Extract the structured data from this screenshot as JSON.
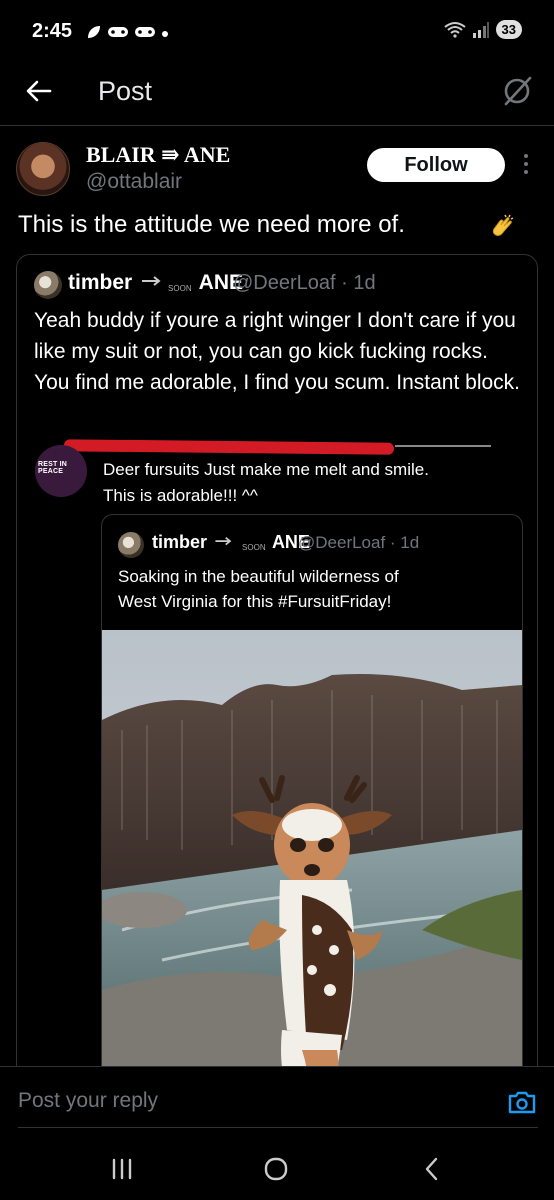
{
  "status": {
    "time": "2:45",
    "battery": "33"
  },
  "nav": {
    "title": "Post"
  },
  "author": {
    "name": "BLAIR ⇛ ANE",
    "handle": "@ottablair",
    "follow_label": "Follow"
  },
  "post": {
    "text": "This is the attitude we need more of."
  },
  "quote": {
    "name_part1": "timber",
    "soon": "SOON",
    "name_part2": "ANE",
    "handle_meta": "@DeerLoaf · 1d",
    "text": "Yeah buddy if youre a right winger I don't care if you like my suit or not, you can go kick fucking rocks. You find me adorable, I find you scum. Instant block."
  },
  "embedded": {
    "avatar_text": "REST IN PEACE",
    "text_line1": "Deer fursuits Just make me melt and smile.",
    "text_line2": "This is adorable!!! ^^"
  },
  "inner_quote": {
    "name_part1": "timber",
    "soon": "SOON",
    "name_part2": "ANE",
    "handle_meta": "@DeerLoaf · 1d",
    "text_line1": "Soaking in the beautiful wilderness of",
    "text_line2": "West Virginia for this #FursuitFriday!"
  },
  "reply": {
    "placeholder": "Post your reply"
  }
}
